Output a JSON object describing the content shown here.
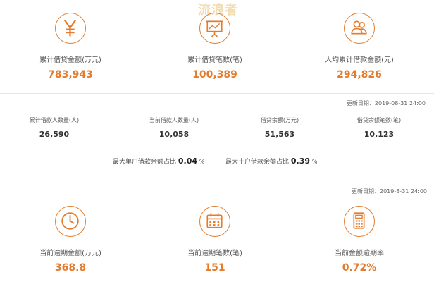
{
  "watermark": "流浪者",
  "top_stats": [
    {
      "icon": "yen-icon",
      "label": "累计借贷金额(万元)",
      "value": "783,943"
    },
    {
      "icon": "presentation-chart-icon",
      "label": "累计借贷笔数(笔)",
      "value": "100,389"
    },
    {
      "icon": "users-icon",
      "label": "人均累计借款金额(元)",
      "value": "294,826"
    }
  ],
  "middle": {
    "update_time": "更新日期：2019-08-31 24:00",
    "stats": [
      {
        "label": "累计借款人数量(人)",
        "value": "26,590"
      },
      {
        "label": "当前借款人数量(人)",
        "value": "10,058"
      },
      {
        "label": "借贷余额(万元)",
        "value": "51,563"
      },
      {
        "label": "借贷余额笔数(笔)",
        "value": "10,123"
      }
    ],
    "ratios": [
      {
        "label": "最大单户借款余额占比",
        "value": "0.04",
        "unit": "%"
      },
      {
        "label": "最大十户借款余额占比",
        "value": "0.39",
        "unit": "%"
      }
    ]
  },
  "bottom": {
    "update_time": "更新日期：2019-8-31 24:00",
    "stats": [
      {
        "icon": "clock-icon",
        "label": "当前逾期金额(万元)",
        "value": "368.8"
      },
      {
        "icon": "calendar-icon",
        "label": "当前逾期笔数(笔)",
        "value": "151"
      },
      {
        "icon": "calculator-icon",
        "label": "当前金额逾期率",
        "value": "0.72%"
      }
    ]
  },
  "colors": {
    "accent": "#e47b2d",
    "divider": "#e5e5e5",
    "text": "#333333"
  }
}
